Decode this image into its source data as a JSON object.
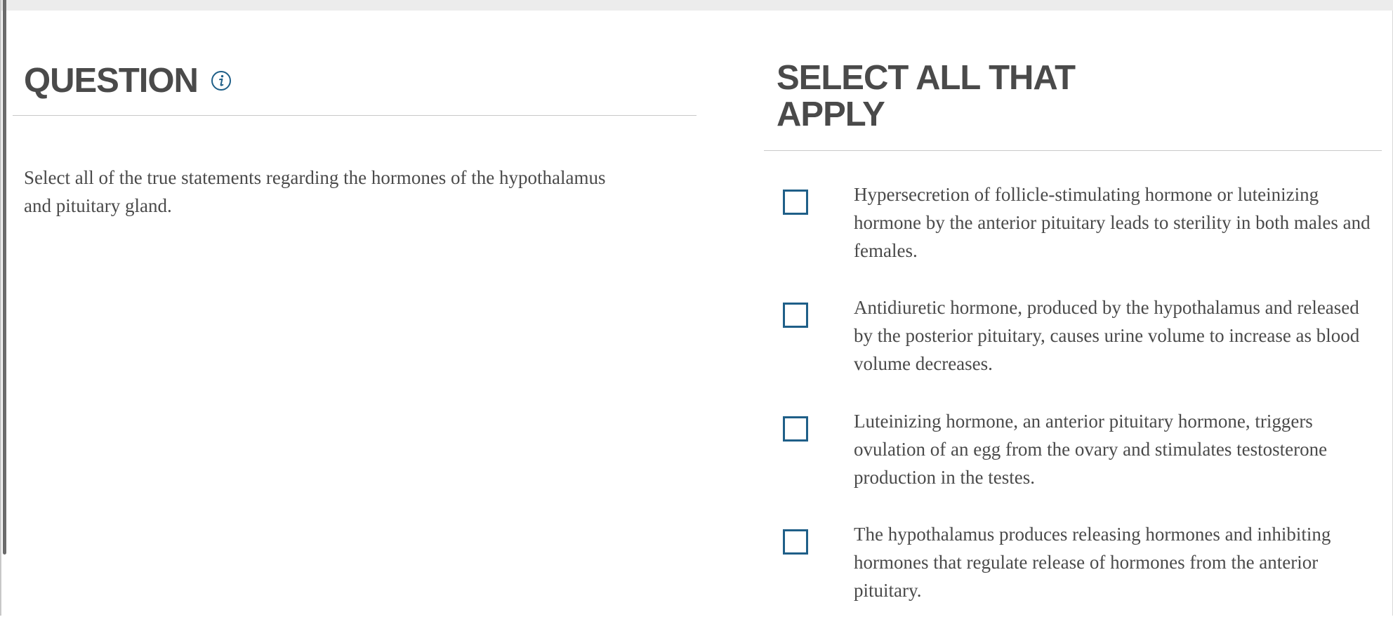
{
  "question": {
    "title": "QUESTION",
    "info_icon": "info-icon",
    "text": "Select all of the true statements regarding the hormones of the hypothalamus and pituitary gland."
  },
  "answers": {
    "title": "SELECT ALL THAT APPLY",
    "choices": [
      {
        "label": "Hypersecretion of follicle-stimulating hormone or luteinizing hormone by the anterior pituitary leads to sterility in both males and females.",
        "checked": false
      },
      {
        "label": "Antidiuretic hormone, produced by the hypothalamus and released by the posterior pituitary, causes urine volume to increase as blood volume decreases.",
        "checked": false
      },
      {
        "label": "Luteinizing hormone, an anterior pituitary hormone, triggers ovulation of an egg from the ovary and stimulates testosterone production in the testes.",
        "checked": false
      },
      {
        "label": "The hypothalamus produces releasing hormones and inhibiting hormones that regulate release of hormones from the anterior pituitary.",
        "checked": false
      }
    ]
  },
  "colors": {
    "accent": "#1f5f88",
    "text": "#4a4a4a",
    "divider": "#c9c9c9",
    "top_bar": "#ececec"
  }
}
